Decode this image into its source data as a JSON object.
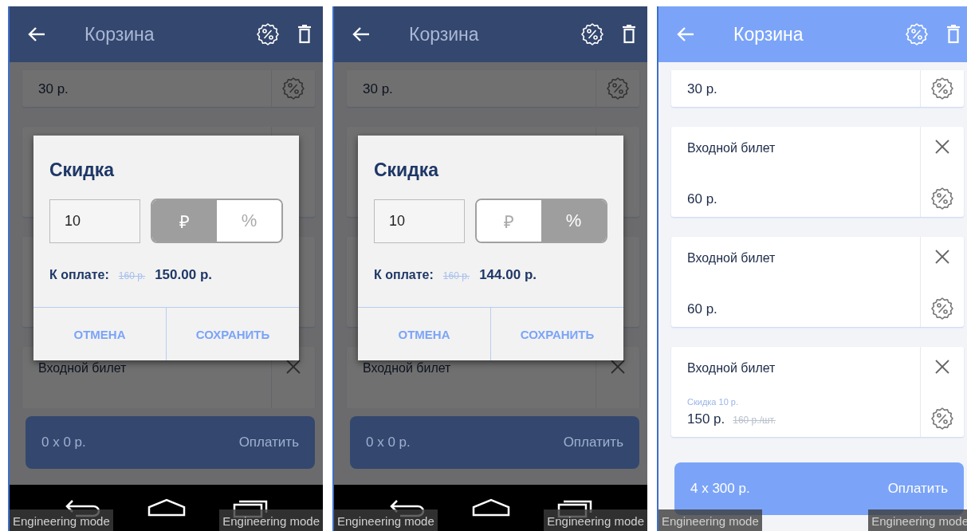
{
  "screens": [
    {
      "header": {
        "title": "Корзина"
      },
      "dimmed": true,
      "items": [
        {
          "price": "30 р.",
          "close": false,
          "discount": true
        },
        {
          "close": false,
          "discount": false
        },
        {
          "close": false,
          "discount": false
        },
        {
          "name": "Входной билет",
          "close": true,
          "discount": false
        }
      ],
      "pay": {
        "summary": "0 x 0 р.",
        "label": "Оплатить"
      },
      "nav_bar": true,
      "dialog": {
        "title": "Скидка",
        "value": "10",
        "units": [
          {
            "label": "₽",
            "selected": true
          },
          {
            "label": "%",
            "selected": false
          }
        ],
        "total_label": "К оплате:",
        "old_total": "160 р.",
        "new_total": "150.00 р.",
        "buttons": [
          "ОТМЕНА",
          "СОХРАНИТЬ"
        ]
      },
      "overlay_labels": [
        "Engineering mode",
        "Engineering mode"
      ]
    },
    {
      "header": {
        "title": "Корзина"
      },
      "dimmed": true,
      "items": [
        {
          "price": "30 р.",
          "close": false,
          "discount": true
        },
        {
          "close": false,
          "discount": false
        },
        {
          "close": false,
          "discount": false
        },
        {
          "name": "Входной билет",
          "close": true,
          "discount": false
        }
      ],
      "pay": {
        "summary": "0 x 0 р.",
        "label": "Оплатить"
      },
      "nav_bar": true,
      "dialog": {
        "title": "Скидка",
        "value": "10",
        "units": [
          {
            "label": "₽",
            "selected": false
          },
          {
            "label": "%",
            "selected": true
          }
        ],
        "total_label": "К оплате:",
        "old_total": "160 р.",
        "new_total": "144.00 р.",
        "buttons": [
          "ОТМЕНА",
          "СОХРАНИТЬ"
        ]
      },
      "overlay_labels": [
        "Engineering mode",
        "Engineering mode"
      ]
    },
    {
      "header": {
        "title": "Корзина"
      },
      "dimmed": false,
      "items": [
        {
          "price": "30 р.",
          "close": false,
          "discount": true
        },
        {
          "name": "Входной билет",
          "price": "60 р.",
          "close": true,
          "discount": true
        },
        {
          "name": "Входной билет",
          "price": "60 р.",
          "close": true,
          "discount": true
        },
        {
          "name": "Входной билет",
          "discount_note": "Скидка 10 р.",
          "price": "150 р.",
          "old_price": "160 р./шт.",
          "close": true,
          "discount": true
        }
      ],
      "pay": {
        "summary": "4 x 300 р.",
        "label": "Оплатить"
      },
      "nav_bar": false,
      "overlay_labels": [
        "Engineering mode",
        "Engineering mode"
      ]
    }
  ]
}
